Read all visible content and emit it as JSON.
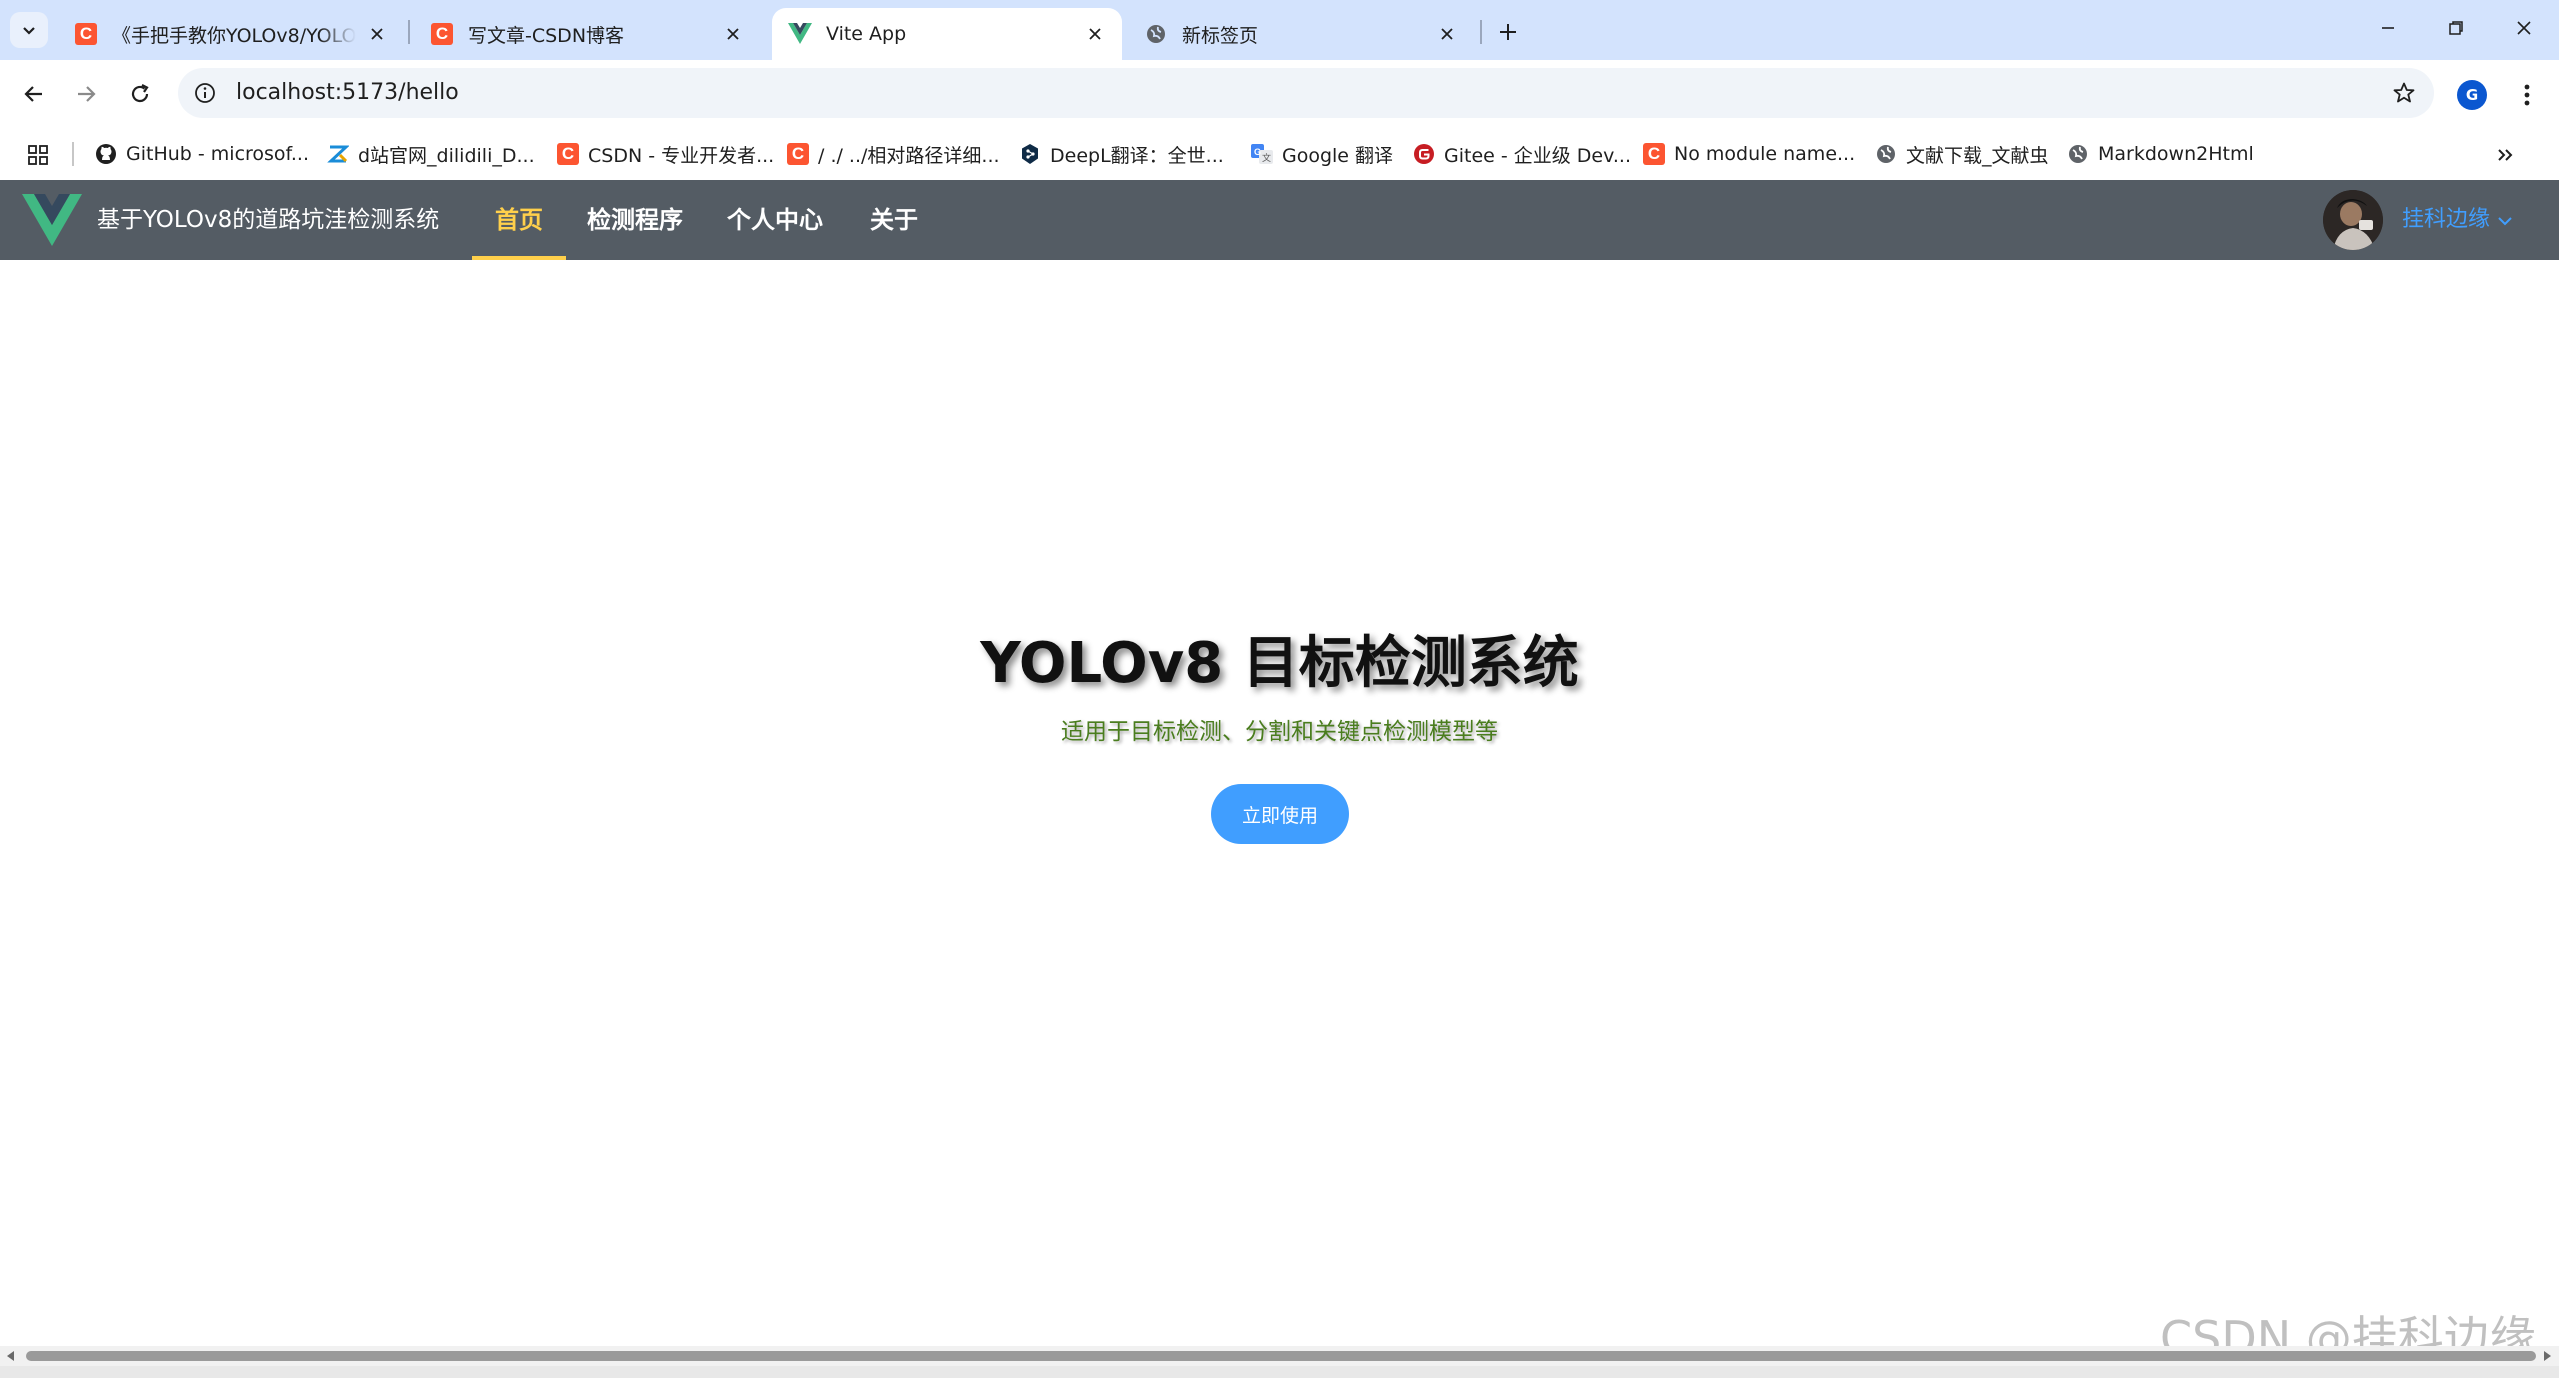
{
  "browser": {
    "tabs": [
      {
        "title": "《手把手教你YOLOv8/YOLOv",
        "favicon": "csdn-icon",
        "active": false
      },
      {
        "title": "写文章-CSDN博客",
        "favicon": "csdn-icon",
        "active": false
      },
      {
        "title": "Vite App",
        "favicon": "vue-icon",
        "active": true
      },
      {
        "title": "新标签页",
        "favicon": "globe-icon",
        "active": false
      }
    ],
    "address": "localhost:5173/hello",
    "profile_initial": "G",
    "bookmarks": [
      {
        "label": "GitHub - microsof...",
        "icon": "github-icon"
      },
      {
        "label": "d站官网_dilidili_D...",
        "icon": "z-icon"
      },
      {
        "label": "CSDN - 专业开发者...",
        "icon": "csdn-icon"
      },
      {
        "label": "/ ./ ../相对路径详细...",
        "icon": "csdn-icon"
      },
      {
        "label": "DeepL翻译：全世...",
        "icon": "deepl-icon"
      },
      {
        "label": "Google 翻译",
        "icon": "google-translate-icon"
      },
      {
        "label": "Gitee - 企业级 Dev...",
        "icon": "gitee-icon"
      },
      {
        "label": "No module name...",
        "icon": "csdn-icon"
      },
      {
        "label": "文献下载_文献虫",
        "icon": "globe-icon"
      },
      {
        "label": "Markdown2Html",
        "icon": "globe-icon"
      }
    ],
    "colors": {
      "tabstrip": "#d3e3fd",
      "omnibox": "#f0f4f9"
    }
  },
  "app": {
    "name": "基于YOLOv8的道路坑洼检测系统",
    "menu": [
      {
        "label": "首页",
        "active": true
      },
      {
        "label": "检测程序",
        "active": false
      },
      {
        "label": "个人中心",
        "active": false
      },
      {
        "label": "关于",
        "active": false
      }
    ],
    "user": {
      "name": "挂科边缘"
    },
    "colors": {
      "header_bg": "#545c64",
      "menu_active": "#ffd04b",
      "link": "#409eff"
    }
  },
  "hero": {
    "title": "YOLOv8 目标检测系统",
    "subtitle": "适用于目标检测、分割和关键点检测模型等",
    "button": "立即使用"
  },
  "watermark": "CSDN @挂科边缘"
}
